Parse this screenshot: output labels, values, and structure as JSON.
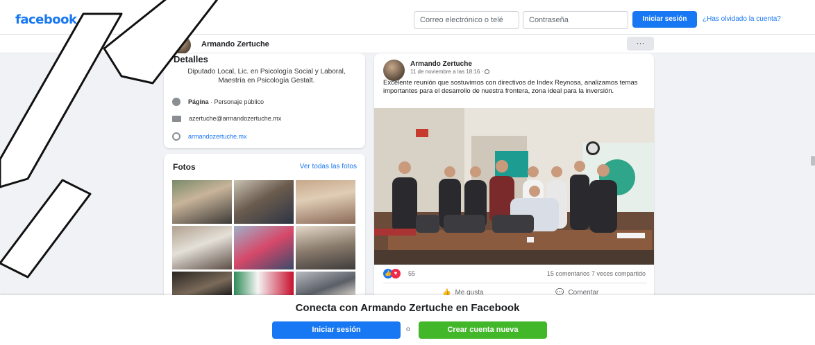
{
  "topbar": {
    "logo": "facebook",
    "email_placeholder": "Correo electrónico o telé",
    "password_placeholder": "Contraseña",
    "login_label": "Iniciar sesión",
    "forgot_label": "¿Has olvidado la cuenta?"
  },
  "profile": {
    "name": "Armando Zertuche",
    "more_label": "···"
  },
  "intro": {
    "title": "Detalles",
    "bio": "Diputado Local, Lic. en Psicología Social y Laboral, Maestría en Psicología Gestalt.",
    "page_label": "Página",
    "page_category": " · Personaje público",
    "email": "azertuche@armandozertuche.mx",
    "website": "armandozertuche.mx"
  },
  "photos": {
    "title": "Fotos",
    "see_all": "Ver todas las fotos"
  },
  "post": {
    "author": "Armando Zertuche",
    "date": "11 de noviembre a las 18:16 · ",
    "text": "Excelente reunión que sostuvimos con directivos de Index Reynosa, analizamos temas importantes para el desarrollo de nuestra frontera, zona ideal para la inversión.",
    "reactions_count": "55",
    "comments_shares": "15 comentarios  7 veces compartido",
    "like_label": "Me gusta",
    "comment_label": "Comentar",
    "colors": {
      "like": "#1877f2",
      "love": "#f02849"
    }
  },
  "bottom": {
    "connect_text": "Conecta con Armando Zertuche en Facebook",
    "login_label": "Iniciar sesión",
    "or_label": "o",
    "create_label": "Crear cuenta nueva"
  },
  "colors": {
    "brand": "#1877f2",
    "create_green": "#42b72a",
    "background": "#f0f2f5"
  },
  "icons": [
    "page-icon",
    "mail-icon",
    "globe-icon",
    "globe-privacy-icon",
    "like-icon",
    "love-icon",
    "thumb-up-icon",
    "comment-icon"
  ]
}
